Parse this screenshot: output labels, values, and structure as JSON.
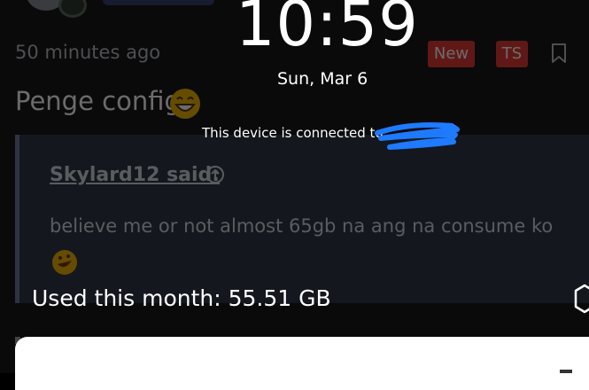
{
  "overlay": {
    "time": "10:59",
    "date": "Sun, Mar 6",
    "connection_text": "This device is connected to",
    "usage_text": "Used this month: 55.51 GB"
  },
  "forum": {
    "post_time": "50 minutes ago",
    "badges": {
      "new": "New",
      "ts": "TS"
    },
    "thread_title": "Penge config",
    "quote": {
      "author": "Skylard12 said:",
      "text": "believe me or not almost 65gb na ang na consume ko"
    }
  },
  "colors": {
    "badge_red": "#e53935",
    "redaction_blue": "#1e7bff",
    "sheet_white": "#ffffff"
  },
  "icons": [
    "bookmark-icon",
    "grinning-emoji-icon",
    "arrow-up-circle-icon",
    "rofl-emoji-icon",
    "shield-icon"
  ]
}
